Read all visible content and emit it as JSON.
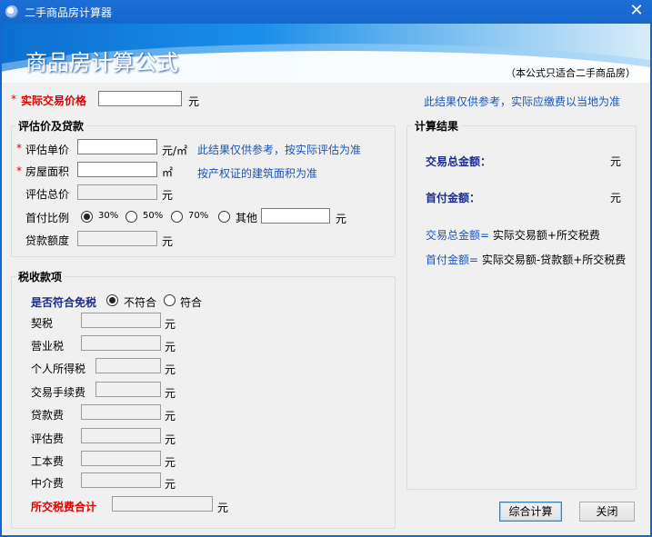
{
  "window": {
    "title": "二手商品房计算器",
    "close": "✕"
  },
  "banner": {
    "title": "商品房计算公式",
    "note": "（本公式只适合二手商品房）"
  },
  "top": {
    "price_label": "实际交易价格",
    "unit_yuan": "元",
    "disclaimer": "此结果仅供参考，实际应缴费以当地为准",
    "price_value": ""
  },
  "assess": {
    "group_title": "评估价及贷款",
    "unit_price_label": "评估单价",
    "unit_price_unit": "元/㎡",
    "unit_price_note": "此结果仅供参考，按实际评估为准",
    "area_label": "房屋面积",
    "area_unit": "㎡",
    "area_note": "按产权证的建筑面积为准",
    "total_label": "评估总价",
    "down_ratio_label": "首付比例",
    "ratio_options": [
      "30%",
      "50%",
      "70%",
      "其他"
    ],
    "selected_ratio": "30%",
    "loan_label": "贷款额度",
    "unit_yuan": "元"
  },
  "tax": {
    "group_title": "税收款项",
    "exempt_label": "是否符合免税",
    "exempt_options": [
      "不符合",
      "符合"
    ],
    "exempt_selected": "不符合",
    "items": [
      "契税",
      "营业税",
      "个人所得税",
      "交易手续费",
      "贷款费",
      "评估费",
      "工本费",
      "中介费"
    ],
    "total_label": "所交税费合计",
    "unit_yuan": "元"
  },
  "result": {
    "group_title": "计算结果",
    "total_label": "交易总金额：",
    "down_label": "首付金额：",
    "unit_yuan": "元",
    "formula1_key": "交易总金额=",
    "formula1_val": " 实际交易额+所交税费",
    "formula2_key": "首付金额=",
    "formula2_val": " 实际交易额-贷款额+所交税费"
  },
  "buttons": {
    "calculate": "综合计算",
    "close": "关闭"
  },
  "colors": {
    "title_bar": "#1667cc",
    "required": "#e00000",
    "note": "#1b54b8",
    "heading": "#1b2c8a"
  }
}
